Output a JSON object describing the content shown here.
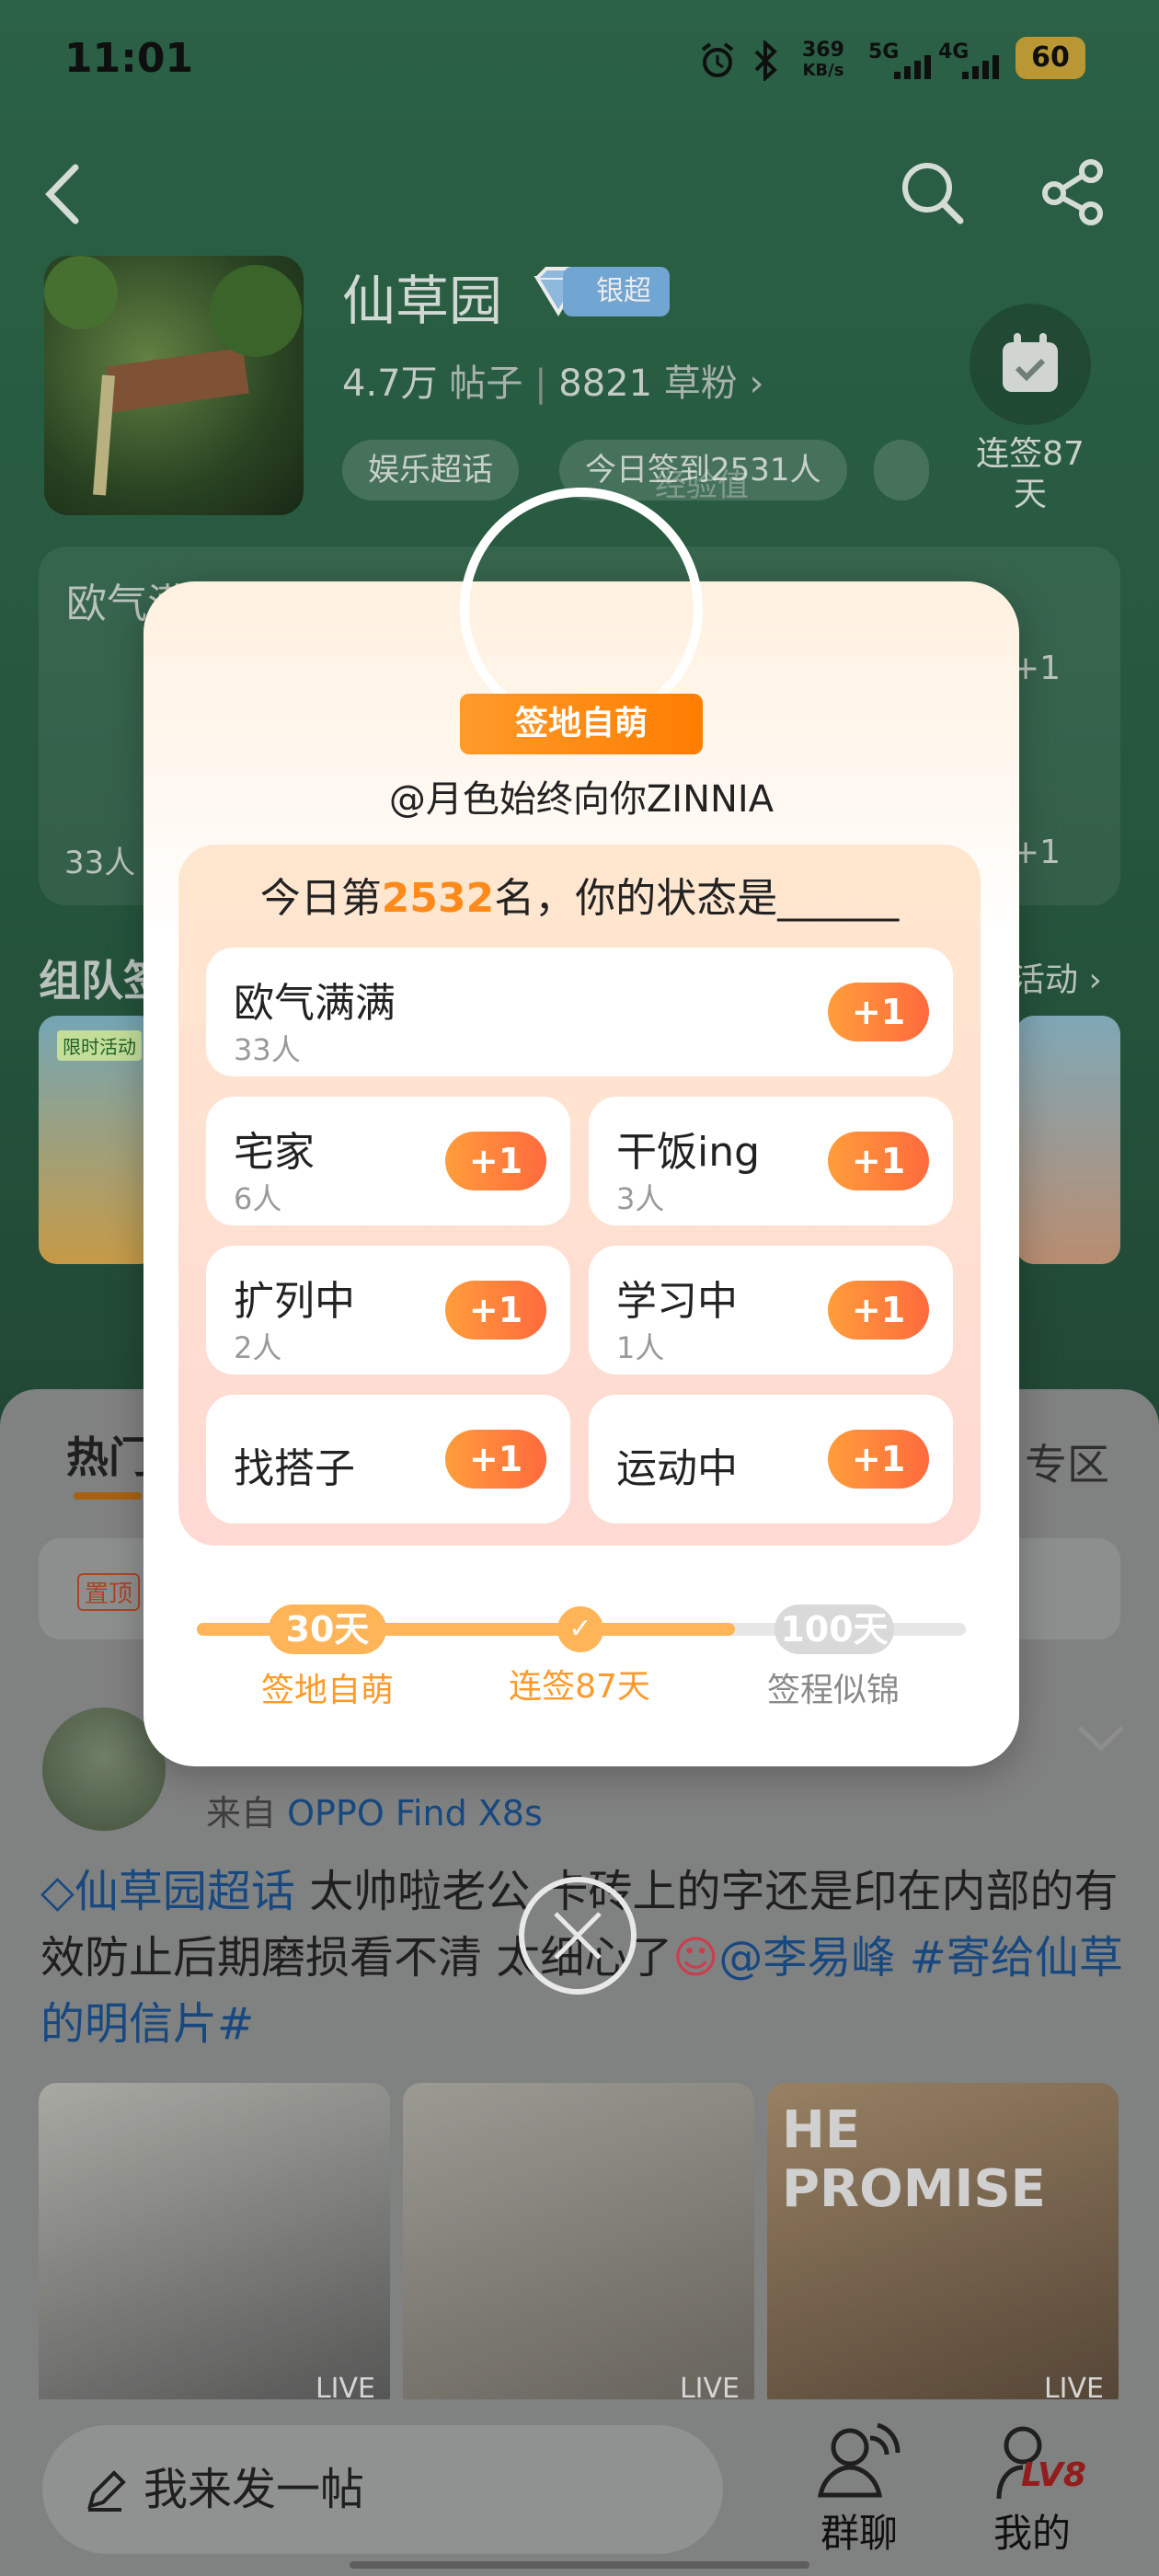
{
  "status_bar": {
    "time": "11:01",
    "speed_value": "369",
    "speed_unit": "KB/s",
    "net1": "5G",
    "net2": "4G",
    "battery": "60"
  },
  "header": {
    "group_name": "仙草园",
    "badge": "银超",
    "posts": "4.7万",
    "posts_label": "帖子",
    "fans": "8821",
    "fans_label": "草粉",
    "chips": [
      "娱乐超话",
      "今日签到2531人"
    ],
    "chip_overlap": "经验值",
    "streak_label_line1": "连签87",
    "streak_label_line2": "天"
  },
  "bg_sections": {
    "card_label": "欧气满满",
    "card_count": "33人",
    "plus": "+1",
    "team_title": "组队签",
    "limited_badge": "限时活动",
    "activity_link": "活动"
  },
  "feed": {
    "tab_hot": "热门",
    "tab_zone": "专区",
    "pinned": "置顶",
    "source_prefix": "来自",
    "source_device": "OPPO Find X8s",
    "post_tag": "仙草园超话",
    "post_text": " 太帅啦老公 卡砖上的字还是印在内部的有效防止后期磨损看不清 太细心了",
    "post_mention": "@李易峰",
    "post_hashtag": "#寄给仙草的明信片#",
    "live_labels": [
      "LIVE",
      "LIVE",
      "LIVE"
    ],
    "photo_text": "HE PROMISE"
  },
  "bottom_bar": {
    "compose": "我来发一帖",
    "group_chat": "群聊",
    "me": "我的",
    "level": "LV8"
  },
  "modal": {
    "ribbon": "签地自萌",
    "username": "@月色始终向你ZINNIA",
    "question_prefix": "今日第",
    "rank": "2532",
    "question_suffix": "名，你的状态是______",
    "options": [
      {
        "name": "欧气满满",
        "count": "33人",
        "plus": "+1"
      },
      {
        "name": "宅家",
        "count": "6人",
        "plus": "+1"
      },
      {
        "name": "干饭ing",
        "count": "3人",
        "plus": "+1"
      },
      {
        "name": "扩列中",
        "count": "2人",
        "plus": "+1"
      },
      {
        "name": "学习中",
        "count": "1人",
        "plus": "+1"
      },
      {
        "name": "找搭子",
        "count": "",
        "plus": "+1"
      },
      {
        "name": "运动中",
        "count": "",
        "plus": "+1"
      }
    ],
    "milestones": [
      {
        "pill": "30天",
        "label": "签地自萌"
      },
      {
        "pill": "✓",
        "label": "连签87天"
      },
      {
        "pill": "100天",
        "label": "签程似锦"
      }
    ],
    "progress_fraction": 0.7
  },
  "colors": {
    "accent_orange": "#ff8a1a",
    "brand_green": "#2f6a4c",
    "link_blue": "#1a4f8a"
  },
  "icons": [
    "back-icon",
    "search-icon",
    "share-icon",
    "calendar-check-icon",
    "close-icon",
    "pencil-icon",
    "group-chat-icon",
    "profile-icon",
    "diamond-icon",
    "chevron-right-icon",
    "chevron-down-icon",
    "alarm-icon",
    "bluetooth-icon"
  ]
}
